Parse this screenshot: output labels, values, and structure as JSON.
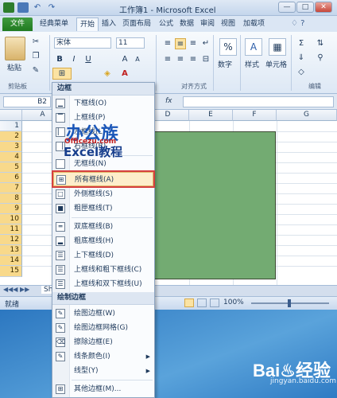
{
  "window": {
    "title": "工作簿1 - Microsoft Excel",
    "minimize": "—",
    "maximize": "□",
    "close": "✕"
  },
  "tabs": [
    "文件",
    "经典菜单",
    "开始",
    "插入",
    "页面布局",
    "公式",
    "数据",
    "审阅",
    "视图",
    "加载项"
  ],
  "ribbon": {
    "paste_label": "粘贴",
    "font_name": "宋体",
    "font_size": "11",
    "bold": "B",
    "italic": "I",
    "underline": "U",
    "number_label": "数字",
    "styles_label": "样式",
    "cells_label": "单元格",
    "groups": {
      "clipboard": "剪贴板",
      "alignment": "对齐方式",
      "editing": "编辑"
    }
  },
  "formula_bar": {
    "cell_ref": "B2",
    "fx": "fx"
  },
  "grid": {
    "columns": [
      "A",
      "B",
      "C",
      "D",
      "E",
      "F",
      "G"
    ],
    "rows": [
      "1",
      "2",
      "3",
      "4",
      "5",
      "6",
      "7",
      "8",
      "9",
      "10",
      "11",
      "12",
      "13",
      "14",
      "15"
    ]
  },
  "sheet_tab": "Sh",
  "status": {
    "ready": "就绪",
    "zoom": "100%"
  },
  "menu": {
    "section_borders": "边框",
    "items_borders": [
      {
        "label": "下框线(O)",
        "icon": "▁"
      },
      {
        "label": "上框线(P)",
        "icon": "▔"
      },
      {
        "label": "左框线(L)",
        "icon": "▏"
      },
      {
        "label": "右框线(R)",
        "icon": "▕"
      },
      {
        "label": "无框线(N)",
        "icon": " "
      },
      {
        "label": "所有框线(A)",
        "icon": "⊞"
      },
      {
        "label": "外侧框线(S)",
        "icon": "□"
      },
      {
        "label": "粗匣框线(T)",
        "icon": "■"
      },
      {
        "label": "双底框线(B)",
        "icon": "═"
      },
      {
        "label": "粗底框线(H)",
        "icon": "▂"
      },
      {
        "label": "上下框线(D)",
        "icon": "☰"
      },
      {
        "label": "上框线和粗下框线(C)",
        "icon": "☰"
      },
      {
        "label": "上框线和双下框线(U)",
        "icon": "☰"
      }
    ],
    "section_draw": "绘制边框",
    "items_draw": [
      {
        "label": "绘图边框(W)",
        "icon": "✎",
        "arrow": ""
      },
      {
        "label": "绘图边框网格(G)",
        "icon": "✎",
        "arrow": ""
      },
      {
        "label": "擦除边框(E)",
        "icon": "⌫",
        "arrow": ""
      },
      {
        "label": "线条颜色(I)",
        "icon": "✎",
        "arrow": "▶"
      },
      {
        "label": "线型(Y)",
        "icon": " ",
        "arrow": "▶"
      },
      {
        "label": "其他边框(M)...",
        "icon": "⊞",
        "arrow": ""
      }
    ]
  },
  "watermark": {
    "brand_cn": "办公族",
    "brand_url": "Officezu.com",
    "brand_sub": "Excel教程",
    "baidu": "Bai♨经验",
    "baidu_url": "jingyan.baidu.com"
  },
  "colors": {
    "selected_range": "#73ab72",
    "file_tab": "#2f8a2f",
    "highlight": "#d64040"
  }
}
